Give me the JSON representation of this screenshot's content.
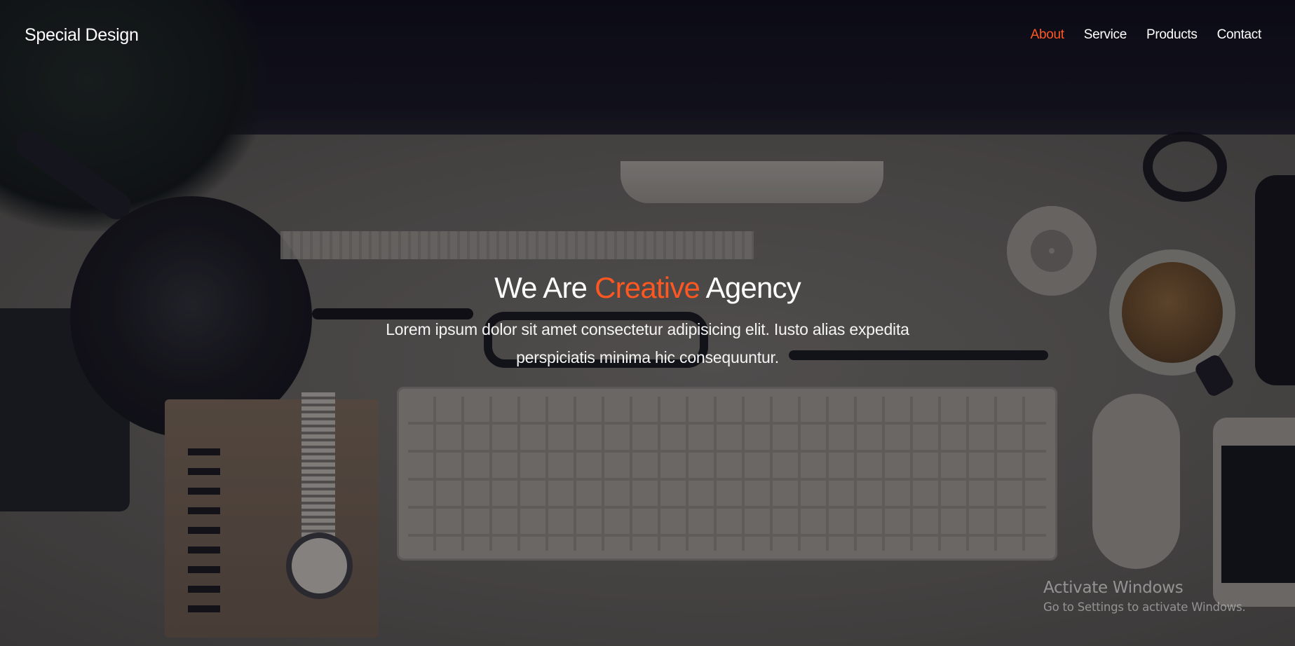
{
  "brand": {
    "logo_text": "Special Design"
  },
  "nav": {
    "items": [
      {
        "label": "About",
        "active": true
      },
      {
        "label": "Service",
        "active": false
      },
      {
        "label": "Products",
        "active": false
      },
      {
        "label": "Contact",
        "active": false
      }
    ]
  },
  "hero": {
    "headline_part1": "We Are ",
    "headline_accent": "Creative",
    "headline_part2": " Agency",
    "lead": "Lorem ipsum dolor sit amet consectetur adipisicing elit. Iusto alias expedita perspiciatis minima hic consequuntur."
  },
  "watermark": {
    "title": "Activate Windows",
    "subtitle": "Go to Settings to activate Windows."
  },
  "colors": {
    "accent": "#ff5722",
    "text": "#ffffff",
    "overlay": "#0c0b14"
  }
}
